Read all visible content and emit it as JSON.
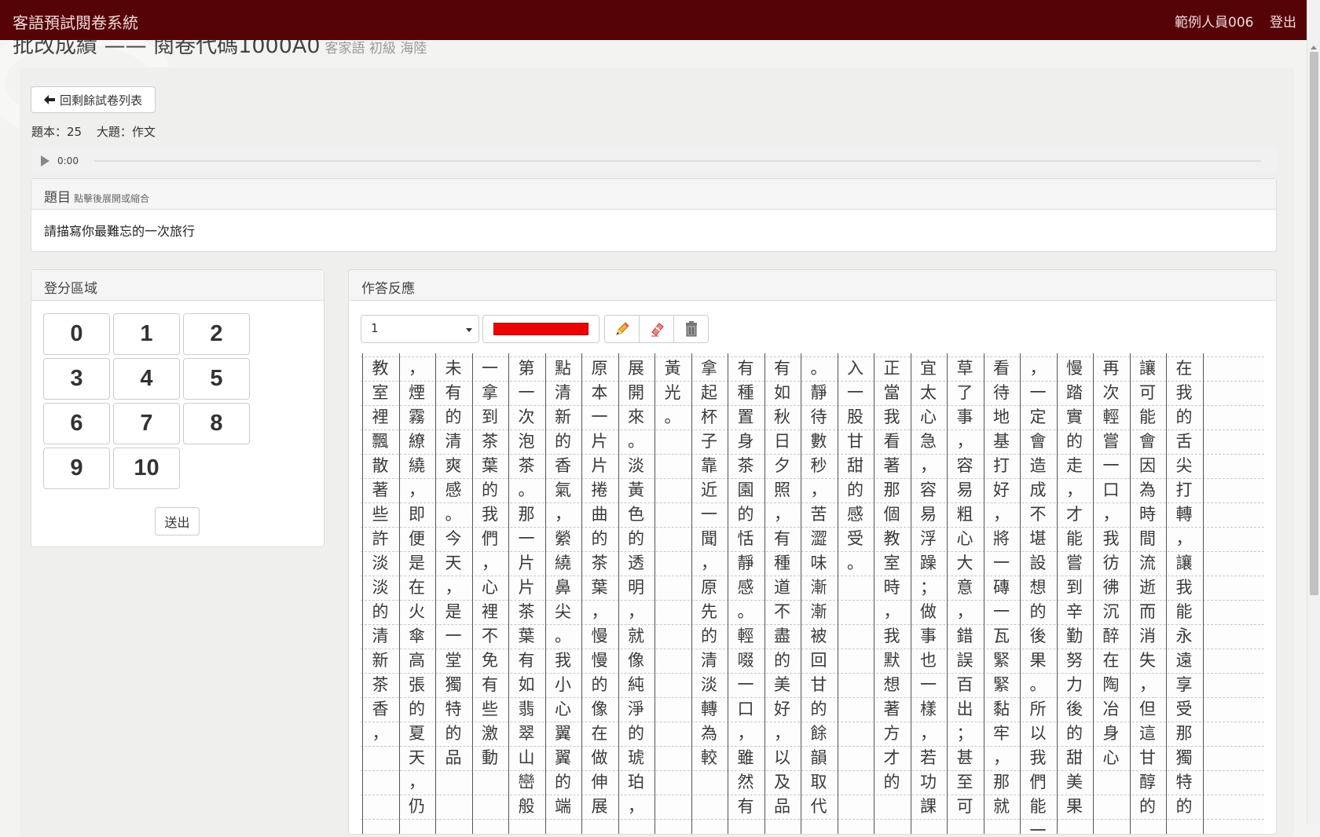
{
  "navbar": {
    "brand": "客語預試閱卷系統",
    "user": "範例人員006",
    "logout": "登出"
  },
  "page": {
    "title": "批改成績 —— 閱卷代碼1000A0",
    "subtitle": "客家語 初級 海陸"
  },
  "back_button": {
    "label": "回剩餘試卷列表",
    "icon": "arrow-left-icon"
  },
  "meta": {
    "booklet": "題本：25",
    "section": "大題：作文"
  },
  "audio": {
    "time": "0:00"
  },
  "question": {
    "heading": "題目",
    "hint": "點擊後展開或縮合",
    "prompt": "請描寫你最難忘的一次旅行"
  },
  "scoring": {
    "heading": "登分區域",
    "scores": [
      "0",
      "1",
      "2",
      "3",
      "4",
      "5",
      "6",
      "7",
      "8",
      "9",
      "10"
    ],
    "submit": "送出"
  },
  "answer": {
    "heading": "作答反應",
    "page_select": "1",
    "pen_color": "#ee0000",
    "tools": [
      "pencil-icon",
      "eraser-icon",
      "trash-icon"
    ]
  },
  "sheet": {
    "columns": [
      "在我的舌尖打轉，讓我能永遠享受那獨特的",
      "讓可能會因為時間流逝而消失，但這甘醇的",
      "再次輕嘗一口，我彷彿沉醉在陶冶身心",
      "慢踏實的走，才能嘗到辛勤努力後的甜美果",
      "，一定會造成不堪設想的後果。所以我們能一",
      "看待地基打好，將一磚一瓦緊緊黏牢，那就",
      "草了事，容易粗心大意，錯誤百出；甚至可",
      "宜太心急，容易浮躁；做事也一樣，若功課",
      "正當我看著那個教室時，我默想著方才的",
      "入一股甘甜的感受。",
      "。靜待數秒，苦澀味漸漸被回甘的餘韻取代",
      "有如秋日夕照，有種道不盡的美好，以及品",
      "有種置身茶園的恬靜感。輕啜一口，雖然有",
      "拿起杯子靠近一聞，原先的清淡轉為較",
      "黃光。",
      "展開來。淡黃色的透明，就像純淨的琥珀，",
      "原本一片片捲曲的茶葉，慢慢的像在做伸展",
      "點清新的香氣，縈繞鼻尖。我小心翼翼的端",
      "第一次泡茶。那一片片茶葉有如翡翠山巒般",
      "一拿到茶葉的我們，心裡不免有些激動",
      "未有的清爽感。今天，是一堂獨特的品",
      "，煙霧繚繞，即便是在火傘高張的夏天，仍",
      "教室裡飄散著些許淡淡的清新茶香，"
    ]
  }
}
